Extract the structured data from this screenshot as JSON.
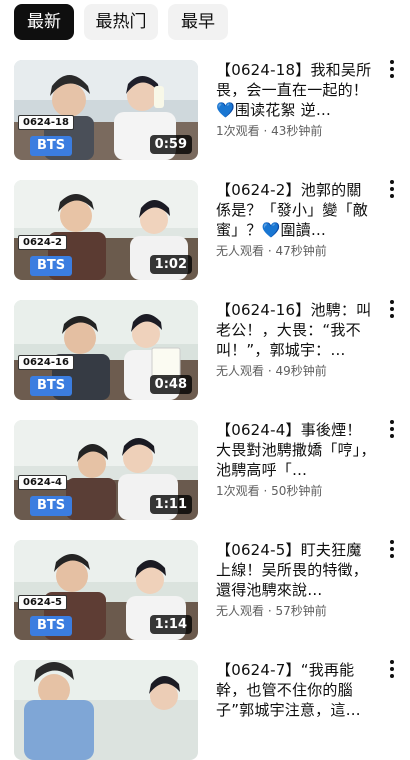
{
  "chips": [
    {
      "label": "最新",
      "active": true
    },
    {
      "label": "最热门",
      "active": false
    },
    {
      "label": "最早",
      "active": false
    }
  ],
  "videos": [
    {
      "tag": "0624-18",
      "logo": "BTS",
      "duration": "0:59",
      "title": "【0624-18】我和吴所畏，会一直在一起的！💙围读花絮 逆…",
      "meta": "1次观看 · 43秒钟前"
    },
    {
      "tag": "0624-2",
      "logo": "BTS",
      "duration": "1:02",
      "title": "【0624-2】池郭的關係是？「發小」變「敵蜜」？💙圍讀…",
      "meta": "无人观看 · 47秒钟前"
    },
    {
      "tag": "0624-16",
      "logo": "BTS",
      "duration": "0:48",
      "title": "【0624-16】池騁：叫老公！，大畏：“我不叫！”，郭城宇：…",
      "meta": "无人观看 · 49秒钟前"
    },
    {
      "tag": "0624-4",
      "logo": "BTS",
      "duration": "1:11",
      "title": "【0624-4】事後煙！大畏對池騁撒嬌「哼」，池騁高呼「…",
      "meta": "1次观看 · 50秒钟前"
    },
    {
      "tag": "0624-5",
      "logo": "BTS",
      "duration": "1:14",
      "title": "【0624-5】盯夫狂魔上線！吴所畏的特徵，還得池騁來說…",
      "meta": "无人观看 · 57秒钟前"
    },
    {
      "tag": "",
      "logo": "",
      "duration": "",
      "title": "【0624-7】“我再能幹，也管不住你的腦子”郭城宇注意，這…",
      "meta": ""
    }
  ]
}
